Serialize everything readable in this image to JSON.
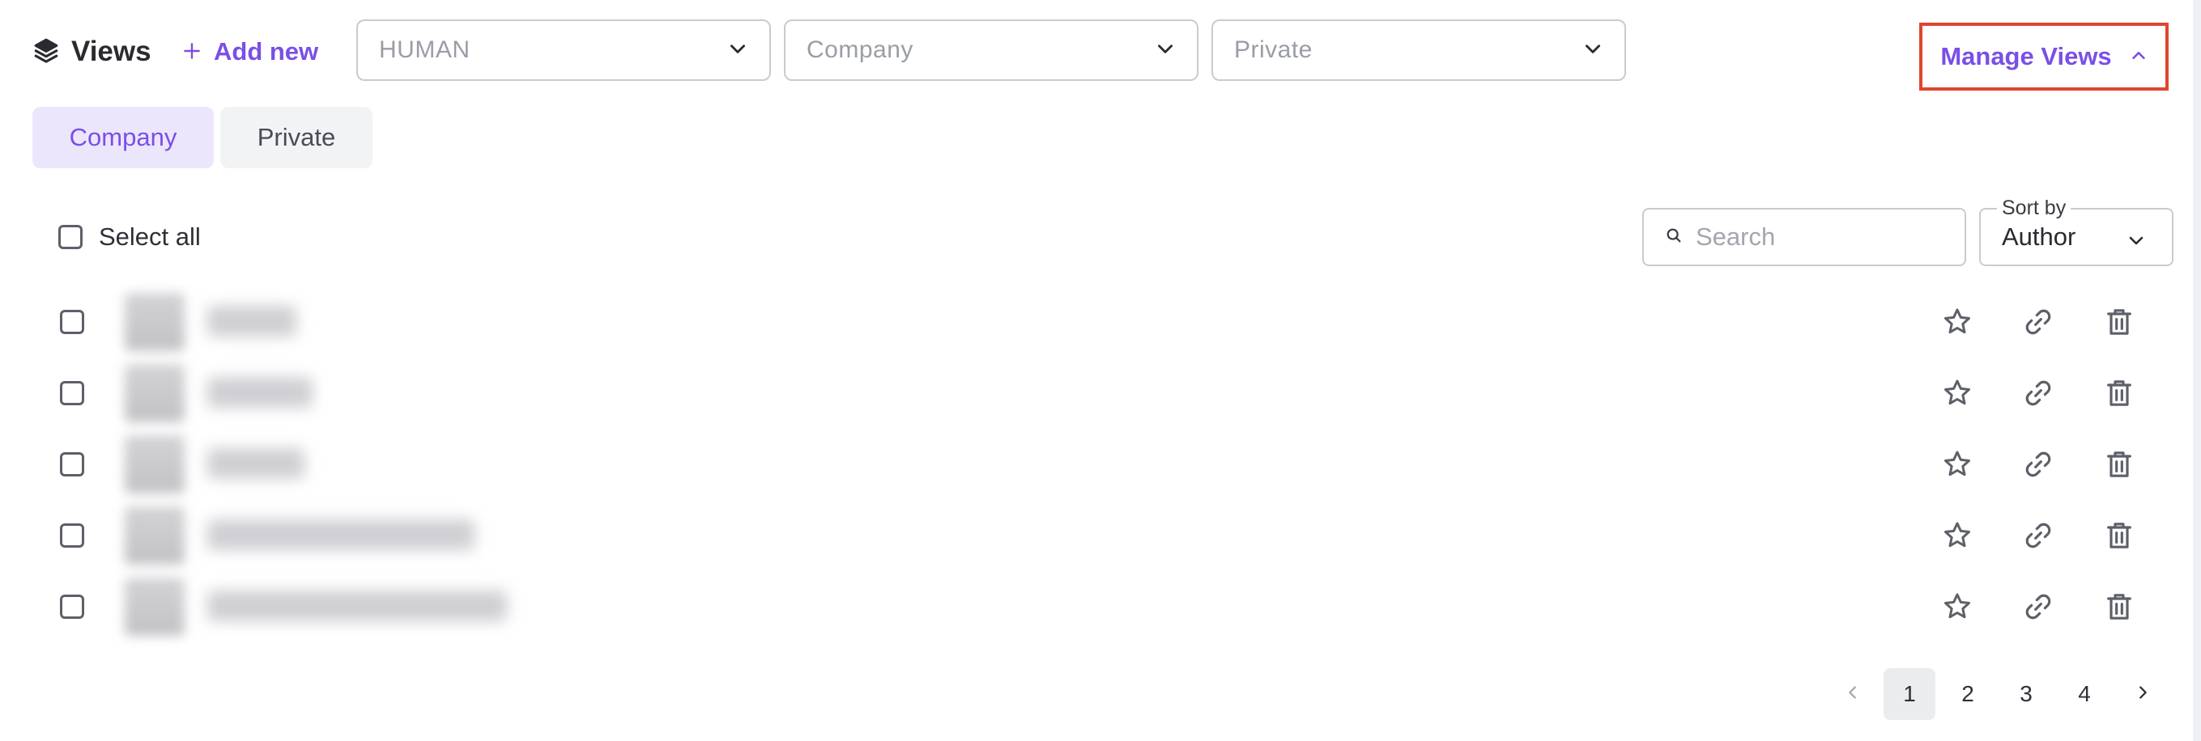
{
  "header": {
    "title": "Views",
    "add_new_label": "Add new",
    "filters": [
      {
        "placeholder": "HUMAN"
      },
      {
        "placeholder": "Company"
      },
      {
        "placeholder": "Private"
      }
    ],
    "manage_views_label": "Manage Views"
  },
  "tabs": [
    {
      "label": "Company",
      "active": true
    },
    {
      "label": "Private",
      "active": false
    }
  ],
  "list": {
    "select_all_label": "Select all",
    "search_placeholder": "Search",
    "sort_by_label": "Sort by",
    "sort_by_value": "Author",
    "rows_count_note": "row names are blurred"
  },
  "pagination": {
    "pages": [
      "1",
      "2",
      "3",
      "4"
    ],
    "current": "1"
  },
  "colors": {
    "accent": "#7a4fe6",
    "highlight_border": "#e0452d",
    "active_tab_bg": "#ece6fd"
  },
  "icons": {
    "title": "layers-icon",
    "row_actions": [
      "star-icon",
      "link-icon",
      "trash-icon"
    ]
  }
}
